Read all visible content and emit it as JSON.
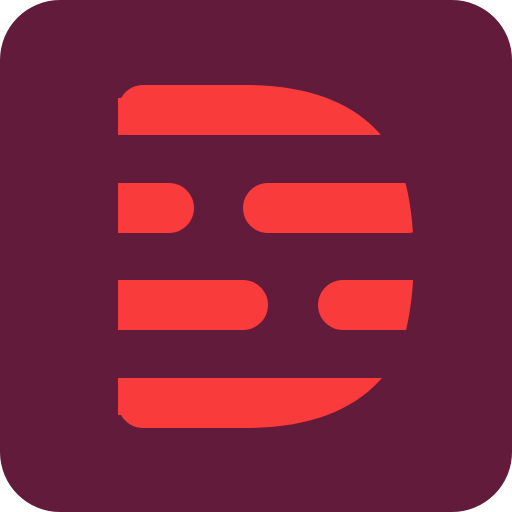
{
  "icon": {
    "name": "app-icon",
    "background_color": "#621B3B",
    "glyph_color": "#FA3B3C",
    "glyph_name": "letter-d-logo"
  }
}
